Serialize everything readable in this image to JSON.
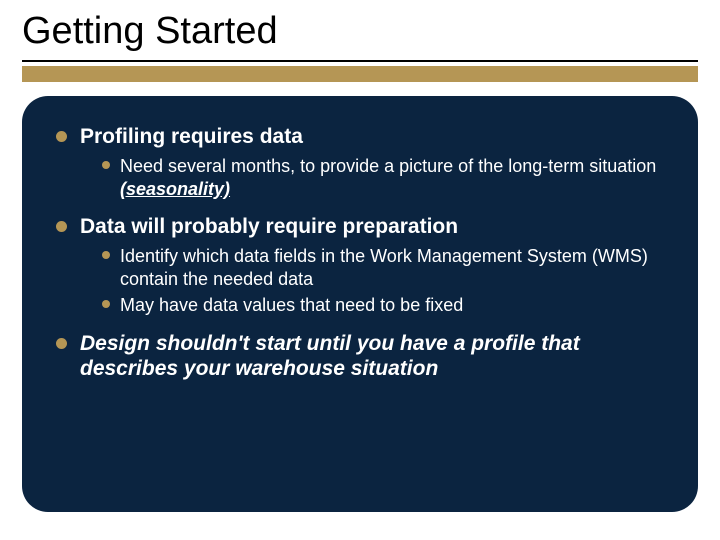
{
  "title": "Getting Started",
  "bullets": {
    "item1": {
      "text": "Profiling requires data",
      "sub1_prefix": "Need several months, to provide a picture of the long-term situation ",
      "sub1_em": "(seasonality)"
    },
    "item2": {
      "text": "Data will probably require preparation",
      "sub1": "Identify which data fields in the Work Management System (WMS) contain the needed data",
      "sub2": "May have data values that need to be fixed"
    },
    "item3": {
      "text": "Design shouldn't start until you have a profile that describes your warehouse situation"
    }
  }
}
